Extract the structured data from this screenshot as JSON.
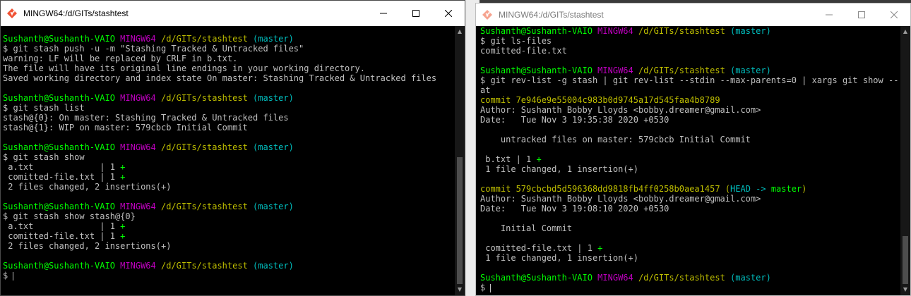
{
  "windows": [
    {
      "title": "MINGW64:/d/GITs/stashtest",
      "lines": [
        [
          {
            "t": "Sushanth@Sushanth-VAIO ",
            "c": "g"
          },
          {
            "t": "MINGW64 ",
            "c": "m"
          },
          {
            "t": "/d/GITs/stashtest ",
            "c": "y"
          },
          {
            "t": "(master)",
            "c": "c"
          }
        ],
        [
          {
            "t": "$ git stash push -u -m \"Stashing Tracked & Untracked files\"",
            "c": "w"
          }
        ],
        [
          {
            "t": "warning: LF will be replaced by CRLF in b.txt.",
            "c": "w"
          }
        ],
        [
          {
            "t": "The file will have its original line endings in your working directory.",
            "c": "w"
          }
        ],
        [
          {
            "t": "Saved working directory and index state On master: Stashing Tracked & Untracked files",
            "c": "w"
          }
        ],
        [],
        [
          {
            "t": "Sushanth@Sushanth-VAIO ",
            "c": "g"
          },
          {
            "t": "MINGW64 ",
            "c": "m"
          },
          {
            "t": "/d/GITs/stashtest ",
            "c": "y"
          },
          {
            "t": "(master)",
            "c": "c"
          }
        ],
        [
          {
            "t": "$ git stash list",
            "c": "w"
          }
        ],
        [
          {
            "t": "stash@{0}: On master: Stashing Tracked & Untracked files",
            "c": "w"
          }
        ],
        [
          {
            "t": "stash@{1}: WIP on master: 579cbcb Initial Commit",
            "c": "w"
          }
        ],
        [],
        [
          {
            "t": "Sushanth@Sushanth-VAIO ",
            "c": "g"
          },
          {
            "t": "MINGW64 ",
            "c": "m"
          },
          {
            "t": "/d/GITs/stashtest ",
            "c": "y"
          },
          {
            "t": "(master)",
            "c": "c"
          }
        ],
        [
          {
            "t": "$ git stash show",
            "c": "w"
          }
        ],
        [
          {
            "t": " a.txt             | 1 ",
            "c": "w"
          },
          {
            "t": "+",
            "c": "g"
          }
        ],
        [
          {
            "t": " comitted-file.txt | 1 ",
            "c": "w"
          },
          {
            "t": "+",
            "c": "g"
          }
        ],
        [
          {
            "t": " 2 files changed, 2 insertions(+)",
            "c": "w"
          }
        ],
        [],
        [
          {
            "t": "Sushanth@Sushanth-VAIO ",
            "c": "g"
          },
          {
            "t": "MINGW64 ",
            "c": "m"
          },
          {
            "t": "/d/GITs/stashtest ",
            "c": "y"
          },
          {
            "t": "(master)",
            "c": "c"
          }
        ],
        [
          {
            "t": "$ git stash show stash@{0}",
            "c": "w"
          }
        ],
        [
          {
            "t": " a.txt             | 1 ",
            "c": "w"
          },
          {
            "t": "+",
            "c": "g"
          }
        ],
        [
          {
            "t": " comitted-file.txt | 1 ",
            "c": "w"
          },
          {
            "t": "+",
            "c": "g"
          }
        ],
        [
          {
            "t": " 2 files changed, 2 insertions(+)",
            "c": "w"
          }
        ],
        [],
        [
          {
            "t": "Sushanth@Sushanth-VAIO ",
            "c": "g"
          },
          {
            "t": "MINGW64 ",
            "c": "m"
          },
          {
            "t": "/d/GITs/stashtest ",
            "c": "y"
          },
          {
            "t": "(master)",
            "c": "c"
          }
        ],
        [
          {
            "t": "$ ",
            "c": "w"
          },
          {
            "cursor": true
          }
        ]
      ]
    },
    {
      "title": "MINGW64:/d/GITs/stashtest",
      "lines": [
        [
          {
            "t": "Sushanth@Sushanth-VAIO ",
            "c": "g"
          },
          {
            "t": "MINGW64 ",
            "c": "m"
          },
          {
            "t": "/d/GITs/stashtest ",
            "c": "y"
          },
          {
            "t": "(master)",
            "c": "c"
          }
        ],
        [
          {
            "t": "$ git ls-files",
            "c": "w"
          }
        ],
        [
          {
            "t": "comitted-file.txt",
            "c": "w"
          }
        ],
        [],
        [
          {
            "t": "Sushanth@Sushanth-VAIO ",
            "c": "g"
          },
          {
            "t": "MINGW64 ",
            "c": "m"
          },
          {
            "t": "/d/GITs/stashtest ",
            "c": "y"
          },
          {
            "t": "(master)",
            "c": "c"
          }
        ],
        [
          {
            "t": "$ git rev-list -g stash | git rev-list --stdin --max-parents=0 | xargs git show --st",
            "c": "w"
          }
        ],
        [
          {
            "t": "at",
            "c": "w"
          }
        ],
        [
          {
            "t": "commit 7e946e9e55004c983b0d9745a17d545faa4b8789",
            "c": "cm"
          }
        ],
        [
          {
            "t": "Author: Sushanth Bobby Lloyds <bobby.dreamer@gmail.com>",
            "c": "w"
          }
        ],
        [
          {
            "t": "Date:   Tue Nov 3 19:35:38 2020 +0530",
            "c": "w"
          }
        ],
        [],
        [
          {
            "t": "    untracked files on master: 579cbcb Initial Commit",
            "c": "w"
          }
        ],
        [],
        [
          {
            "t": " b.txt | 1 ",
            "c": "w"
          },
          {
            "t": "+",
            "c": "g"
          }
        ],
        [
          {
            "t": " 1 file changed, 1 insertion(+)",
            "c": "w"
          }
        ],
        [],
        [
          {
            "t": "commit 579cbcbd5d596368dd9818fb4ff0258b0aea1457 ",
            "c": "cm"
          },
          {
            "t": "(",
            "c": "cm"
          },
          {
            "t": "HEAD -> ",
            "c": "c"
          },
          {
            "t": "master",
            "c": "g"
          },
          {
            "t": ")",
            "c": "cm"
          }
        ],
        [
          {
            "t": "Author: Sushanth Bobby Lloyds <bobby.dreamer@gmail.com>",
            "c": "w"
          }
        ],
        [
          {
            "t": "Date:   Tue Nov 3 19:08:10 2020 +0530",
            "c": "w"
          }
        ],
        [],
        [
          {
            "t": "    Initial Commit",
            "c": "w"
          }
        ],
        [],
        [
          {
            "t": " comitted-file.txt | 1 ",
            "c": "w"
          },
          {
            "t": "+",
            "c": "g"
          }
        ],
        [
          {
            "t": " 1 file changed, 1 insertion(+)",
            "c": "w"
          }
        ],
        [],
        [
          {
            "t": "Sushanth@Sushanth-VAIO ",
            "c": "g"
          },
          {
            "t": "MINGW64 ",
            "c": "m"
          },
          {
            "t": "/d/GITs/stashtest ",
            "c": "y"
          },
          {
            "t": "(master)",
            "c": "c"
          }
        ],
        [
          {
            "t": "$ ",
            "c": "w"
          },
          {
            "cursor": true
          }
        ]
      ]
    }
  ]
}
